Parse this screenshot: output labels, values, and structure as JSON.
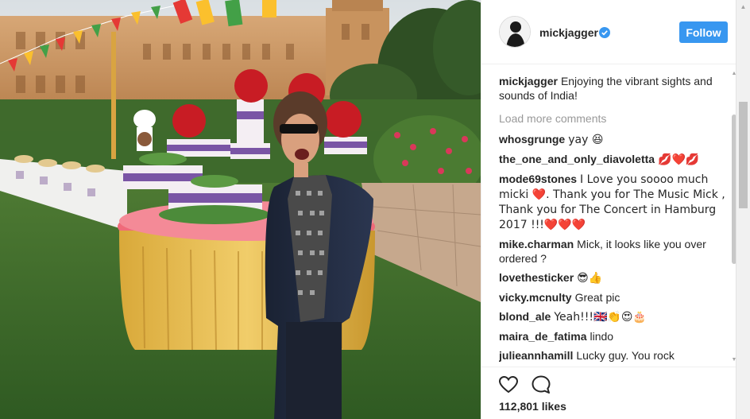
{
  "post": {
    "username": "mickjagger",
    "follow_label": "Follow",
    "verified": true,
    "accent_color": "#3897f0"
  },
  "caption": {
    "username": "mickjagger",
    "text": "Enjoying the vibrant sights and sounds of India!"
  },
  "load_more_label": "Load more comments",
  "comments": [
    {
      "username": "whosgrunge",
      "text": "yay 😆"
    },
    {
      "username": "the_one_and_only_diavoletta",
      "text": "💋❤️💋"
    },
    {
      "username": "mode69stones",
      "text": "I Love you soooo much micki ❤️. Thank you for The Music Mick , Thank you for The Concert in Hamburg 2017 !!!❤️❤️❤️"
    },
    {
      "username": "mike.charman",
      "text": "Mick, it looks like you over ordered ?"
    },
    {
      "username": "lovethesticker",
      "text": "😎👍"
    },
    {
      "username": "vicky.mcnulty",
      "text": "Great pic"
    },
    {
      "username": "blond_ale",
      "text": "Yeah!!!🇬🇧👏😍🎂"
    },
    {
      "username": "maira_de_fatima",
      "text": "lindo"
    },
    {
      "username": "julieannhamill",
      "text": "Lucky guy. You rock handsome"
    }
  ],
  "actions": {
    "like_icon": "heart-outline-icon",
    "comment_icon": "speech-bubble-icon"
  },
  "likes_label": "112,801 likes"
}
